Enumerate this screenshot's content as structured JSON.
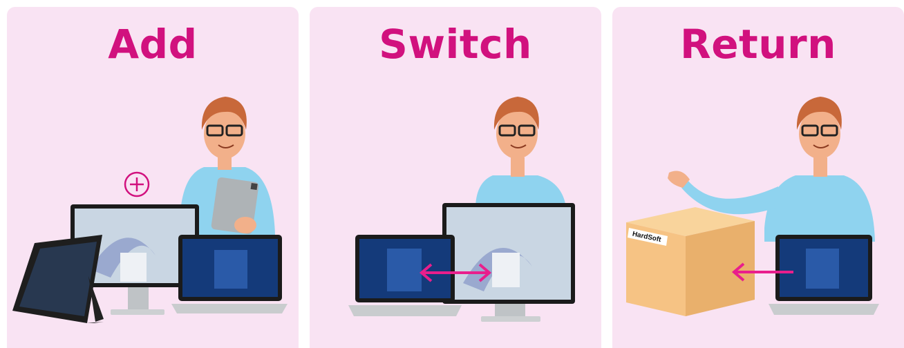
{
  "colors": {
    "card_bg": "#f9e3f3",
    "accent": "#d1117e",
    "shirt": "#8fd3ef",
    "hair": "#c8683a",
    "skin": "#f2b08a",
    "box": "#f6c384"
  },
  "cards": [
    {
      "title": "Add",
      "icon": "plus-circle-icon",
      "illustration": "man-with-tablet-and-devices"
    },
    {
      "title": "Switch",
      "icon": "double-arrow-icon",
      "illustration": "man-behind-laptop-and-all-in-one"
    },
    {
      "title": "Return",
      "icon": "arrow-left-icon",
      "illustration": "man-presenting-box-and-laptop",
      "box_label": "HardSoft"
    }
  ]
}
